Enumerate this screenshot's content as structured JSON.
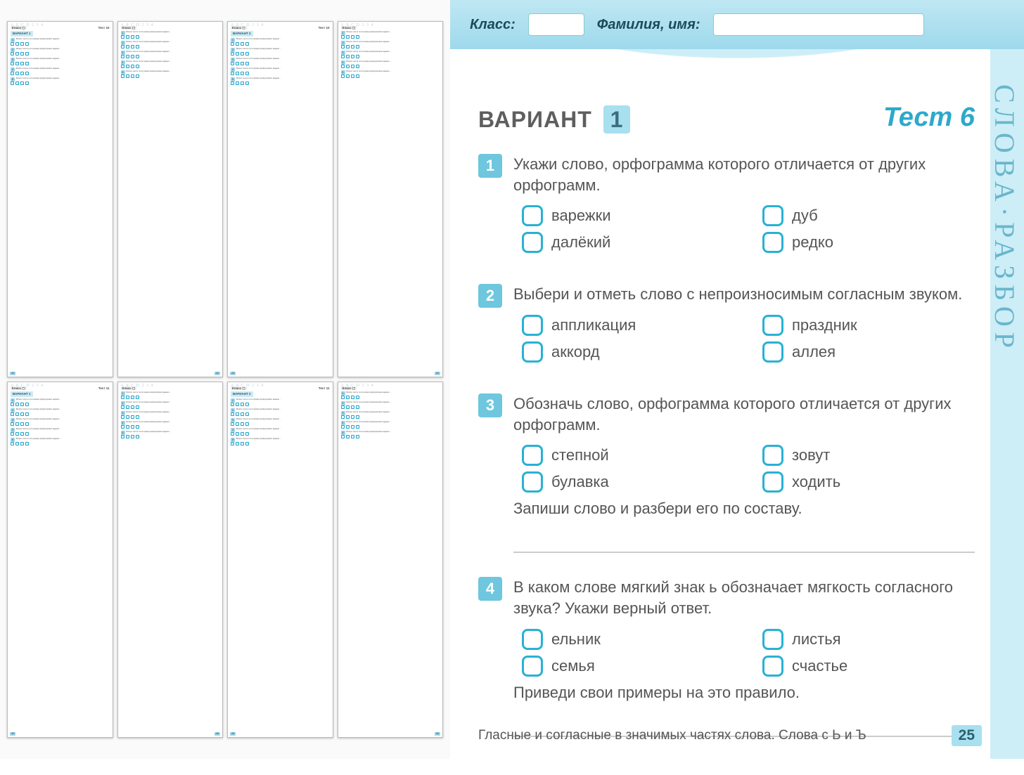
{
  "thumbnails": [
    {
      "test_label": "Тест 10",
      "variant": "ВАРИАНТ 1",
      "page": "43",
      "page_side": "left"
    },
    {
      "test_label": "",
      "variant": "",
      "page": "44",
      "page_side": "right"
    },
    {
      "test_label": "Тест 10",
      "variant": "ВАРИАНТ 2",
      "page": "43",
      "page_side": "left"
    },
    {
      "test_label": "",
      "variant": "",
      "page": "44",
      "page_side": "right"
    },
    {
      "test_label": "Тест 11",
      "variant": "ВАРИАНТ 1",
      "page": "45",
      "page_side": "left"
    },
    {
      "test_label": "",
      "variant": "",
      "page": "46",
      "page_side": "right"
    },
    {
      "test_label": "Тест 11",
      "variant": "ВАРИАНТ 2",
      "page": "45",
      "page_side": "left"
    },
    {
      "test_label": "",
      "variant": "",
      "page": "46",
      "page_side": "right"
    }
  ],
  "header": {
    "klass_label": "Класс:",
    "name_label": "Фамилия, имя:"
  },
  "title": {
    "variant_word": "ВАРИАНТ",
    "variant_num": "1",
    "test_label": "Тест 6"
  },
  "questions": [
    {
      "num": "1",
      "text": "Укажи слово, орфограмма которого отличается от других орфограмм.",
      "options": [
        "варежки",
        "дуб",
        "далёкий",
        "редко"
      ]
    },
    {
      "num": "2",
      "text": "Выбери и отметь слово с непроизносимым согласным звуком.",
      "options": [
        "аппликация",
        "праздник",
        "аккорд",
        "аллея"
      ]
    },
    {
      "num": "3",
      "text": "Обозначь слово, орфограмма которого отличается от других орфограмм.",
      "options": [
        "степной",
        "зовут",
        "булавка",
        "ходить"
      ],
      "sub": "Запиши слово и разбери его по составу.",
      "lines": 1
    },
    {
      "num": "4",
      "text": "В каком слове мягкий знак ь обозначает мягкость согласного звука? Укажи верный ответ.",
      "options": [
        "ельник",
        "листья",
        "семья",
        "счастье"
      ],
      "sub": "Приведи свои примеры на это правило.",
      "lines": 1
    }
  ],
  "footer": {
    "topic": "Гласные и согласные в значимых частях слова. Слова с Ь и Ъ",
    "page": "25"
  },
  "doodle_text": "СЛОВА·РАЗБОР"
}
